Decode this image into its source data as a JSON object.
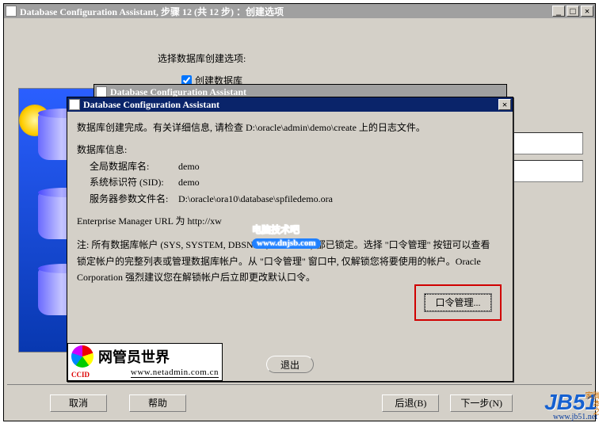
{
  "outer_win": {
    "title": "Database Configuration Assistant, 步骤 12 (共 12 步) ：创建选项"
  },
  "page": {
    "heading": "选择数据库创建选项:",
    "create_db_checkbox": "创建数据库",
    "create_db_checked": true
  },
  "mid_win": {
    "title": "Database Configuration Assistant"
  },
  "dialog": {
    "title": "Database Configuration Assistant",
    "line1": "数据库创建完成。有关详细信息, 请检查 D:\\oracle\\admin\\demo\\create 上的日志文件。",
    "info_heading": "数据库信息:",
    "rows": [
      {
        "label": "全局数据库名:",
        "value": "demo"
      },
      {
        "label": "系统标识符 (SID):",
        "value": "demo"
      },
      {
        "label": "服务器参数文件名:",
        "value": "D:\\oracle\\ora10\\database\\spfiledemo.ora"
      }
    ],
    "em_url_label": "Enterprise Manager URL 为 http://xw",
    "note1": "注: 所有数据库帐户 (SYS, SYSTEM, DBSNMP, SYSMAN) 都已锁定。选择 \"口令管理\" 按钮可以查看锁定帐户的完整列表或管理数据库帐户。从 \"口令管理\" 窗口中, 仅解锁您将要使用的帐户。Oracle Corporation 强烈建议您在解锁帐户后立即更改默认口令。",
    "manage_btn": "口令管理...",
    "exit_btn": "退出"
  },
  "buttons": {
    "cancel": "取消",
    "help": "帮助",
    "back": "后退(B)",
    "next": "下一步(N)"
  },
  "netadmin": {
    "brand": "网管员世界",
    "ccid": "CCID",
    "url": "www.netadmin.com.cn"
  },
  "watermark1": {
    "text": "电脑技术吧",
    "url": "www.dnjsb.com"
  },
  "watermark2": {
    "logo": "JB51",
    "url": "www.jb51.net",
    "cn": "脚本之家"
  }
}
